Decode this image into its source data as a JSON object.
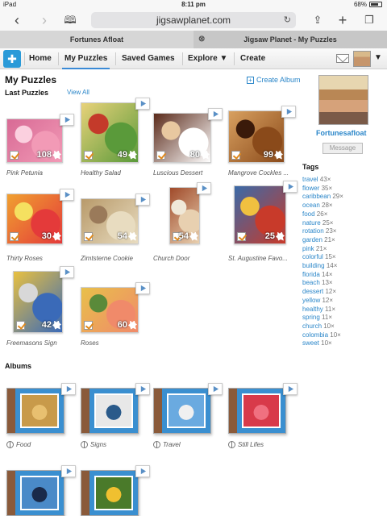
{
  "status": {
    "carrier": "iPad",
    "time": "8:11 pm",
    "battery": "68%"
  },
  "browser": {
    "url": "jigsawplanet.com",
    "tabs": [
      {
        "label": "Fortunes Afloat"
      },
      {
        "label": "Jigsaw Planet - My Puzzles"
      }
    ]
  },
  "nav": {
    "items": [
      "Home",
      "My Puzzles",
      "Saved Games",
      "Explore ▼",
      "Create"
    ]
  },
  "page": {
    "title": "My Puzzles",
    "create_album": "Create Album",
    "last_puzzles_label": "Last Puzzles",
    "view_all": "View All",
    "albums_label": "Albums"
  },
  "puzzles": [
    {
      "name": "Pink Petunia",
      "pieces": "108",
      "colors": [
        "#f29ab6",
        "#d86a95",
        "#fbd0df"
      ]
    },
    {
      "name": "Healthy Salad",
      "pieces": "49",
      "colors": [
        "#5a9a3a",
        "#e8d27a",
        "#c43a2a"
      ]
    },
    {
      "name": "Luscious Dessert",
      "pieces": "80",
      "colors": [
        "#ffffff",
        "#5a2a1a",
        "#e8c8a0"
      ]
    },
    {
      "name": "Mangrove Cockles ...",
      "pieces": "99",
      "colors": [
        "#8a4a1a",
        "#d8a060",
        "#3a1a0a"
      ]
    },
    {
      "name": "Thirty Roses",
      "pieces": "30",
      "colors": [
        "#e43a3a",
        "#f0a030",
        "#f5e060"
      ]
    },
    {
      "name": "Zimtsterne Cookie",
      "pieces": "54",
      "colors": [
        "#e8dcc0",
        "#b89a6a",
        "#9a7a5a"
      ]
    },
    {
      "name": "Church Door",
      "pieces": "54",
      "colors": [
        "#e8d0b0",
        "#a04a2a",
        "#f0e8d8"
      ]
    },
    {
      "name": "St. Augustine Favo...",
      "pieces": "25",
      "colors": [
        "#c83a2a",
        "#3a6aa8",
        "#f0c040"
      ]
    },
    {
      "name": "Freemasons Sign",
      "pieces": "42",
      "colors": [
        "#3a6ab8",
        "#e8c040",
        "#d8d8d8"
      ]
    },
    {
      "name": "Roses",
      "pieces": "60",
      "colors": [
        "#f08a6a",
        "#e8c04a",
        "#5a8a3a"
      ]
    }
  ],
  "profile": {
    "username": "Fortunesafloat",
    "message_label": "Message"
  },
  "tags": {
    "title": "Tags",
    "items": [
      {
        "name": "travel",
        "count": "43×"
      },
      {
        "name": "flower",
        "count": "35×"
      },
      {
        "name": "caribbean",
        "count": "29×"
      },
      {
        "name": "ocean",
        "count": "28×"
      },
      {
        "name": "food",
        "count": "26×"
      },
      {
        "name": "nature",
        "count": "25×"
      },
      {
        "name": "rotation",
        "count": "23×"
      },
      {
        "name": "garden",
        "count": "21×"
      },
      {
        "name": "pink",
        "count": "21×"
      },
      {
        "name": "colorful",
        "count": "15×"
      },
      {
        "name": "building",
        "count": "14×"
      },
      {
        "name": "florida",
        "count": "14×"
      },
      {
        "name": "beach",
        "count": "13×"
      },
      {
        "name": "dessert",
        "count": "12×"
      },
      {
        "name": "yellow",
        "count": "12×"
      },
      {
        "name": "healthy",
        "count": "11×"
      },
      {
        "name": "spring",
        "count": "11×"
      },
      {
        "name": "church",
        "count": "10×"
      },
      {
        "name": "colombia",
        "count": "10×"
      },
      {
        "name": "sweet",
        "count": "10×"
      }
    ]
  },
  "albums": [
    {
      "name": "Food",
      "colors": [
        "#c89a4a",
        "#e8c070"
      ]
    },
    {
      "name": "Signs",
      "colors": [
        "#e8e8e8",
        "#2a5a8a"
      ]
    },
    {
      "name": "Travel",
      "colors": [
        "#6aaae0",
        "#f0f0f0"
      ]
    },
    {
      "name": "Still Lifes",
      "colors": [
        "#d83a4a",
        "#f07080"
      ]
    },
    {
      "name": "",
      "colors": [
        "#4a8ac8",
        "#1a2a4a"
      ]
    },
    {
      "name": "",
      "colors": [
        "#4a7a2a",
        "#f0c030"
      ]
    }
  ],
  "colors": {
    "link": "#2a86c9",
    "accent": "#3a8ad6",
    "check": "#e08a1e"
  }
}
